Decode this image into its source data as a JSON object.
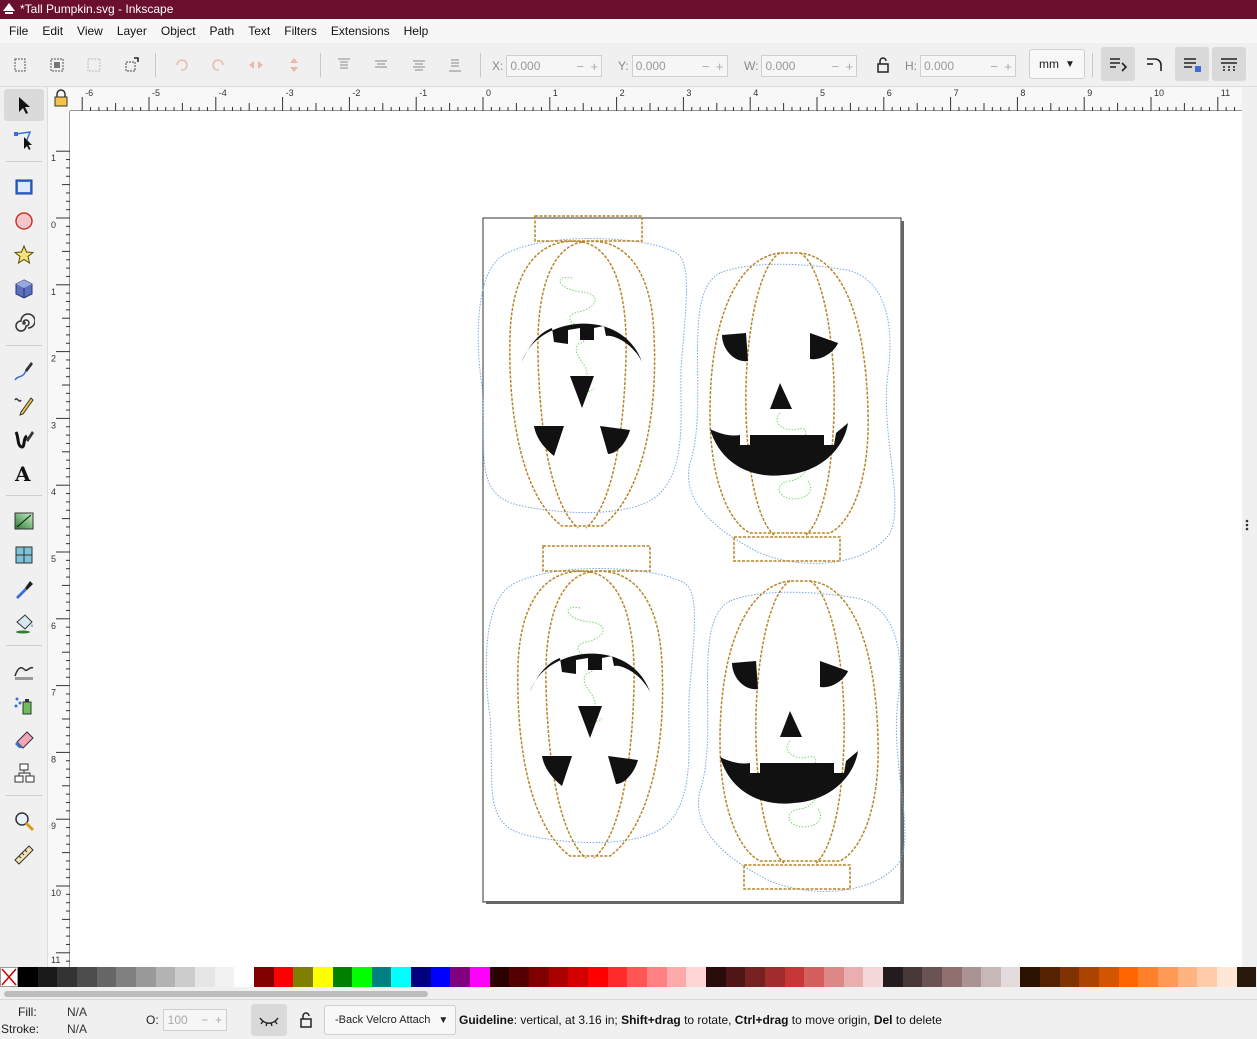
{
  "window": {
    "title": "*Tall Pumpkin.svg - Inkscape",
    "app_icon": "inkscape-icon"
  },
  "menu": [
    "File",
    "Edit",
    "View",
    "Layer",
    "Object",
    "Path",
    "Text",
    "Filters",
    "Extensions",
    "Help"
  ],
  "toolbar": {
    "x_label": "X:",
    "x_value": "0.000",
    "y_label": "Y:",
    "y_value": "0.000",
    "w_label": "W:",
    "w_value": "0.000",
    "h_label": "H:",
    "h_value": "0.000",
    "unit": "mm",
    "plus": "+",
    "minus": "−"
  },
  "tools": [
    "selector",
    "node",
    "rectangle",
    "ellipse",
    "star",
    "3d-box",
    "spiral",
    "pen",
    "pencil",
    "calligraphy",
    "text",
    "gradient",
    "mesh",
    "dropper",
    "paint-bucket",
    "tweak",
    "spray",
    "eraser",
    "connector",
    "zoom",
    "measure"
  ],
  "ruler": {
    "h_ticks": [
      "-6",
      "-5",
      "-4",
      "-3",
      "-2",
      "-1",
      "0",
      "1",
      "2",
      "3",
      "4",
      "5",
      "6",
      "7",
      "8",
      "9",
      "10",
      "11"
    ],
    "v_ticks": [
      "1",
      "0",
      "1",
      "2",
      "3",
      "4",
      "5",
      "6",
      "7",
      "8",
      "9",
      "10",
      "11"
    ]
  },
  "palette": [
    "#000000",
    "#1a1a1a",
    "#333333",
    "#4d4d4d",
    "#666666",
    "#808080",
    "#999999",
    "#b3b3b3",
    "#cccccc",
    "#e6e6e6",
    "#f2f2f2",
    "#ffffff",
    "#800000",
    "#ff0000",
    "#808000",
    "#ffff00",
    "#008000",
    "#00ff00",
    "#008080",
    "#00ffff",
    "#000080",
    "#0000ff",
    "#800080",
    "#ff00ff",
    "#2b0000",
    "#550000",
    "#800000",
    "#aa0000",
    "#d40000",
    "#ff0000",
    "#ff2a2a",
    "#ff5555",
    "#ff8080",
    "#ffaaaa",
    "#ffd5d5",
    "#280b0b",
    "#501616",
    "#782121",
    "#a02c2c",
    "#c83737",
    "#d35f5f",
    "#de8787",
    "#e9afaf",
    "#f4d7d7",
    "#241c1c",
    "#483737",
    "#6c5353",
    "#916f6f",
    "#ac9393",
    "#c8b7b7",
    "#e3dbdb",
    "#2b1100",
    "#552200",
    "#803300",
    "#aa4400",
    "#d45500",
    "#ff6600",
    "#ff7f2a",
    "#ff9955",
    "#ffb380",
    "#ffccaa",
    "#ffe6d5",
    "#28170b"
  ],
  "status": {
    "fill_label": "Fill:",
    "fill_value": "N/A",
    "stroke_label": "Stroke:",
    "stroke_value": "N/A",
    "opacity_label": "O:",
    "opacity_value": "100",
    "layer": "-Back Velcro Attach",
    "message_kind": "Guideline",
    "message_part1": ": vertical, at 3.16 in; ",
    "shift_drag": "Shift+drag",
    "message_part2": " to rotate, ",
    "ctrl_drag": "Ctrl+drag",
    "message_part3": " to move origin, ",
    "del": "Del",
    "message_part4": " to delete"
  }
}
